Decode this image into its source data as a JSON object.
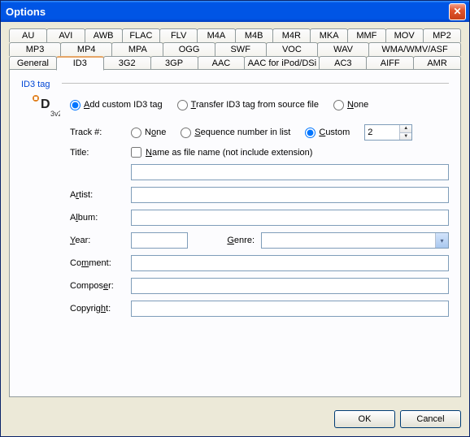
{
  "window": {
    "title": "Options"
  },
  "tabs": {
    "row1": [
      "AU",
      "AVI",
      "AWB",
      "FLAC",
      "FLV",
      "M4A",
      "M4B",
      "M4R",
      "MKA",
      "MMF",
      "MOV",
      "MP2"
    ],
    "row2": [
      "MP3",
      "MP4",
      "MPA",
      "OGG",
      "SWF",
      "VOC",
      "WAV",
      "WMA/WMV/ASF"
    ],
    "row3": [
      "General",
      "ID3",
      "3G2",
      "3GP",
      "AAC",
      "AAC for iPod/DSi",
      "AC3",
      "AIFF",
      "AMR"
    ],
    "active": "ID3"
  },
  "panel": {
    "section_label": "ID3 tag",
    "mode": {
      "add": "Add custom ID3 tag",
      "transfer": "Transfer ID3 tag from source file",
      "none": "None",
      "selected": "add"
    },
    "track": {
      "label": "Track #:",
      "none": "None",
      "seq": "Sequence number in list",
      "custom": "Custom",
      "selected": "custom",
      "value": "2"
    },
    "title": {
      "label": "Title:",
      "checkbox": "Name as file name (not include extension)",
      "checked": false,
      "value": ""
    },
    "artist": {
      "label": "Artist:",
      "value": ""
    },
    "album": {
      "label": "Album:",
      "value": ""
    },
    "year": {
      "label": "Year:",
      "value": ""
    },
    "genre": {
      "label": "Genre:",
      "value": ""
    },
    "comment": {
      "label": "Comment:",
      "value": ""
    },
    "composer": {
      "label": "Composer:",
      "value": ""
    },
    "copyright": {
      "label": "Copyright:",
      "value": ""
    }
  },
  "buttons": {
    "ok": "OK",
    "cancel": "Cancel"
  }
}
